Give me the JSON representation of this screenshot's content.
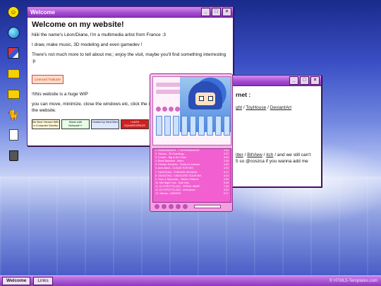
{
  "taskbar": {
    "tasks": [
      "Welcome",
      "Links"
    ],
    "credit": "© HTML5-Templates.com"
  },
  "welcome": {
    "title": "Welcome",
    "heading": "Welcome on my website!",
    "p1": "hiiiii the name's Léon/Diane, I'm a multimedia artist from France :3",
    "p2": "I draw, make music, 3D modeling and even gamedev !",
    "p3": "There's not much more to tell about me;; enjoy the visit, maybe you'll find something interresting :p",
    "badge": "Licenced Traducte",
    "p4": "!!this website is a huge WIP",
    "p5": "you can move, minimize, close the windows etc, click the icons on the left to navigate through the website.",
    "buttons": [
      "Be Best Viewed With a Computer Monitor",
      "Made with Notepad++",
      "Hosted by NeoCities",
      "I HATE SQUARESPACE",
      ""
    ]
  },
  "links": {
    "title": "Links",
    "heading": "rnet :",
    "row1": [
      "ght",
      "ToyHouse",
      "DeviantArt"
    ],
    "row2": [
      "itter",
      "BitView",
      "itch"
    ],
    "row2_tail": "/ and we still can't",
    "row3": "5 so @coszca if you wanna add me"
  },
  "player": {
    "tracks": [
      {
        "name": "1. ROBHANDERS - T WOODMANDER",
        "time": "3:34"
      },
      {
        "name": "2. Yakuza - 3D Grandlogo",
        "time": "3:27"
      },
      {
        "name": "3. Cruiser - Big in Da Clubs",
        "time": "4:03"
      },
      {
        "name": "4. Blank Banshee - Metro",
        "time": "3:26"
      },
      {
        "name": "5. Ghettos Sondello - Fields for summer",
        "time": "4:00"
      },
      {
        "name": "6. Aces Band - CLIQUE EOR MIX",
        "time": "4:02"
      },
      {
        "name": "7. TAKEOOKA - FASHION DESIGNS",
        "time": "3:17"
      },
      {
        "name": "8. TAKEOOKA - KINGSLEEE SOUR MIX",
        "time": "4:14"
      },
      {
        "name": "9. Tezlo & Diplomats - Hidden Patterns",
        "time": "4:00"
      },
      {
        "name": "10. Mid Night Club - Club Intro",
        "time": "5:49"
      },
      {
        "name": "11. DJ SYROTTA ZAG - SPIRAL WARP",
        "time": "7:24"
      },
      {
        "name": "12. DJ SYROTTA ZAG - interlopitus",
        "time": "5:22"
      },
      {
        "name": "13. Yakuza - GARDEN",
        "time": "6:17"
      }
    ]
  }
}
